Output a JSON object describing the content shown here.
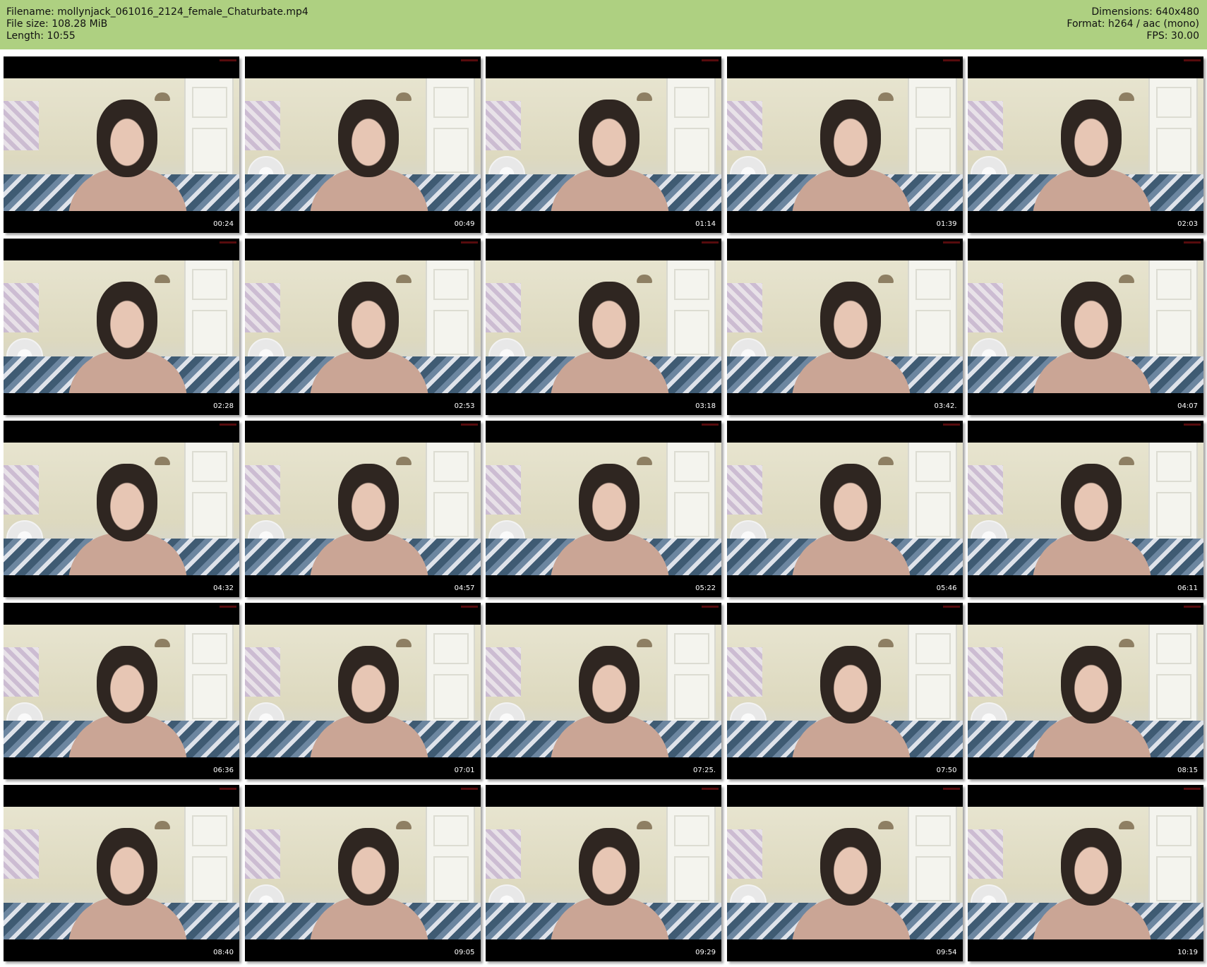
{
  "header": {
    "filename": "Filename: mollynjack_061016_2124_female_Chaturbate.mp4",
    "filesize": "File size: 108.28 MiB",
    "length": "Length: 10:55",
    "dimensions": "Dimensions: 640x480",
    "format": "Format: h264 / aac (mono)",
    "fps": "FPS: 30.00"
  },
  "thumbnails": [
    {
      "time": "00:24"
    },
    {
      "time": "00:49"
    },
    {
      "time": "01:14"
    },
    {
      "time": "01:39"
    },
    {
      "time": "02:03"
    },
    {
      "time": "02:28"
    },
    {
      "time": "02:53"
    },
    {
      "time": "03:18"
    },
    {
      "time": "03:42."
    },
    {
      "time": "04:07"
    },
    {
      "time": "04:32"
    },
    {
      "time": "04:57"
    },
    {
      "time": "05:22"
    },
    {
      "time": "05:46"
    },
    {
      "time": "06:11"
    },
    {
      "time": "06:36"
    },
    {
      "time": "07:01"
    },
    {
      "time": "07:25."
    },
    {
      "time": "07:50"
    },
    {
      "time": "08:15"
    },
    {
      "time": "08:40"
    },
    {
      "time": "09:05"
    },
    {
      "time": "09:29"
    },
    {
      "time": "09:54"
    },
    {
      "time": "10:19"
    }
  ],
  "colors": {
    "header_bg": "#aed081",
    "thumb_bg": "#000000"
  }
}
